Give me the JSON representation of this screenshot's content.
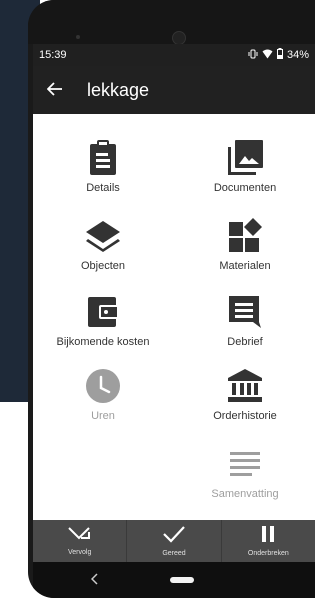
{
  "status_bar": {
    "time": "15:39",
    "battery": "34%"
  },
  "app_bar": {
    "title": "lekkage"
  },
  "tiles": {
    "details": "Details",
    "documenten": "Documenten",
    "objecten": "Objecten",
    "materialen": "Materialen",
    "bijkomende_kosten": "Bijkomende kosten",
    "debrief": "Debrief",
    "uren": "Uren",
    "orderhistorie": "Orderhistorie",
    "samenvatting": "Samenvatting"
  },
  "bottom_bar": {
    "vervolg": "Vervolg",
    "gereed": "Gereed",
    "onderbreken": "Onderbreken"
  },
  "colors": {
    "icon": "#333333",
    "disabled": "#9e9e9e",
    "appbar": "#212121",
    "bottombar": "#4a4a4a"
  }
}
